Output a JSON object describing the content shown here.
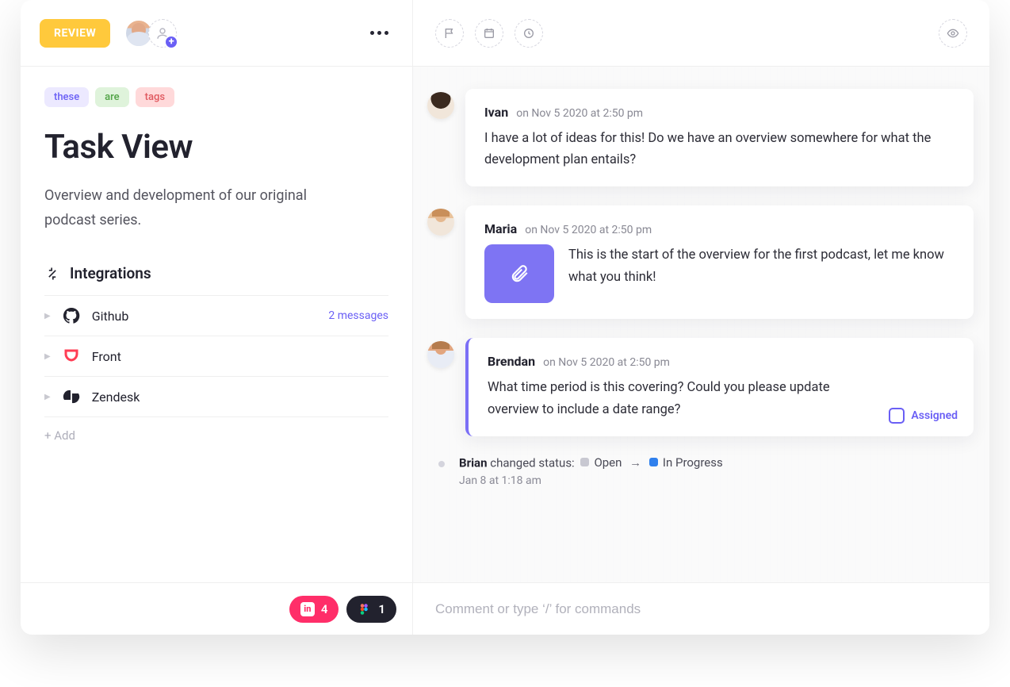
{
  "header": {
    "status": "REVIEW"
  },
  "tags": [
    {
      "label": "these",
      "cls": "t1"
    },
    {
      "label": "are",
      "cls": "t2"
    },
    {
      "label": "tags",
      "cls": "t3"
    }
  ],
  "task": {
    "title": "Task View",
    "description": "Overview and development of our original podcast series."
  },
  "integrations": {
    "title": "Integrations",
    "items": [
      {
        "name": "Github",
        "meta": "2 messages",
        "kind": "github"
      },
      {
        "name": "Front",
        "meta": "",
        "kind": "front"
      },
      {
        "name": "Zendesk",
        "meta": "",
        "kind": "zendesk"
      }
    ],
    "add_label": "+ Add"
  },
  "footer_pills": [
    {
      "count": "4",
      "cls": "pink",
      "app": "invision"
    },
    {
      "count": "1",
      "cls": "dark",
      "app": "figma"
    }
  ],
  "comments": [
    {
      "author": "Ivan",
      "timestamp": "on Nov 5 2020 at 2:50 pm",
      "text": "I have a lot of ideas for this! Do we have an overview somewhere for what the development plan entails?",
      "attachment": false,
      "assigned": false,
      "avatar": "ivan"
    },
    {
      "author": "Maria",
      "timestamp": "on Nov 5 2020 at 2:50 pm",
      "text": "This is the start of the overview for the first podcast, let me know what you think!",
      "attachment": true,
      "assigned": false,
      "avatar": "maria"
    },
    {
      "author": "Brendan",
      "timestamp": "on Nov 5 2020 at 2:50 pm",
      "text": "What time period is this covering? Could you please update overview to include a date range?",
      "attachment": false,
      "assigned": true,
      "assigned_label": "Assigned",
      "avatar": "brendan"
    }
  ],
  "activity": {
    "actor": "Brian",
    "verb": "changed status:",
    "from": "Open",
    "to": "In Progress",
    "time": "Jan 8 at 1:18 am"
  },
  "compose": {
    "placeholder": "Comment or type ‘/’ for commands"
  }
}
